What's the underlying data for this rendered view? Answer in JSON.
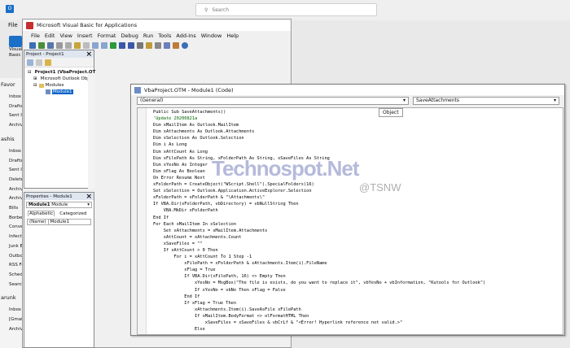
{
  "outlook": {
    "search_placeholder": "Search",
    "file_tab": "File",
    "ribbon_btn_labels": [
      "Visual",
      "Basic"
    ],
    "nav": {
      "favorites_header": "Favor",
      "favorites_items": [
        "Inbox",
        "Drafts",
        "Sent It",
        "Archiv"
      ],
      "account_header": "ashis",
      "account_items": [
        "Inbox",
        "Drafts",
        "Sent It",
        "Delete",
        "Archiv",
        "Archiv",
        "Bills",
        "Borbe",
        "Conve",
        "Infecte",
        "Junk E",
        "Outbo",
        "RSS Fe",
        "Sched",
        "Search"
      ],
      "account2_header": "arunk",
      "account2_items": [
        "Inbox",
        "[Gmail",
        "Archiv"
      ]
    }
  },
  "vba": {
    "title": "Microsoft Visual Basic for Applications",
    "menu": [
      "File",
      "Edit",
      "View",
      "Insert",
      "Format",
      "Debug",
      "Run",
      "Tools",
      "Add-Ins",
      "Window",
      "Help"
    ]
  },
  "project": {
    "title": "Project - Project1",
    "tree": [
      "Project1 (VbaProject.OT",
      "Microsoft Outlook Objec",
      "Modules",
      "Module1"
    ]
  },
  "properties": {
    "title": "Properties - Module1",
    "object": "Module1",
    "object_type": "Module",
    "tabs": [
      "Alphabetic",
      "Categorized"
    ],
    "row_name": "(Name)",
    "row_value": "Module1"
  },
  "code": {
    "title": "VbaProject.OTM - Module1 (Code)",
    "object_select": "(General)",
    "proc_select": "SaveAttachments",
    "tooltip": "Object",
    "lines": [
      "Public Sub SaveAttachments()",
      "'Update 20200821a",
      "Dim xMailItem As Outlook.MailItem",
      "Dim xAttachments As Outlook.Attachments",
      "Dim xSelection As Outlook.Selection",
      "Dim i As Long",
      "Dim xAttCount As Long",
      "Dim xFilePath As String, xFolderPath As String, xSaveFiles As String",
      "Dim xYesNo As Integer",
      "Dim xFlag As Boolean",
      "On Error Resume Next",
      "xFolderPath = CreateObject(\"WScript.Shell\").SpecialFolders(16)",
      "Set xSelection = Outlook.Application.ActiveExplorer.Selection",
      "xFolderPath = xFolderPath & \"\\Attachments\\\"",
      "If VBA.Dir(xFolderPath, vbDirectory) = vbNullString Then",
      "    VBA.MkDir xFolderPath",
      "End If",
      "For Each xMailItem In xSelection",
      "    Set xAttachments = xMailItem.Attachments",
      "    xAttCount = xAttachments.Count",
      "    xSaveFiles = \"\"",
      "    If xAttCount > 0 Then",
      "        For i = xAttCount To 1 Step -1",
      "            xFilePath = xFolderPath & xAttachments.Item(i).FileName",
      "            xFlag = True",
      "            If VBA.Dir(xFilePath, 16) <> Empty Then",
      "                xYesNo = MsgBox(\"The file is exists, do you want to replace it\", vbYesNo + vbInformation, \"Kutools for Outlook\")",
      "                If xYesNo = vbNo Then xFlag = False",
      "            End If",
      "            If xFlag = True Then",
      "                xAttachments.Item(i).SaveAsFile xFilePath",
      "                If xMailItem.BodyFormat <> olFormatHTML Then",
      "                    xSaveFiles = xSaveFiles & vbCrLf & \"<Error! Hyperlink reference not valid.>\"",
      "                Else"
    ]
  },
  "watermark": {
    "brand": "Technospot.Net",
    "handle": "@TSNW"
  }
}
